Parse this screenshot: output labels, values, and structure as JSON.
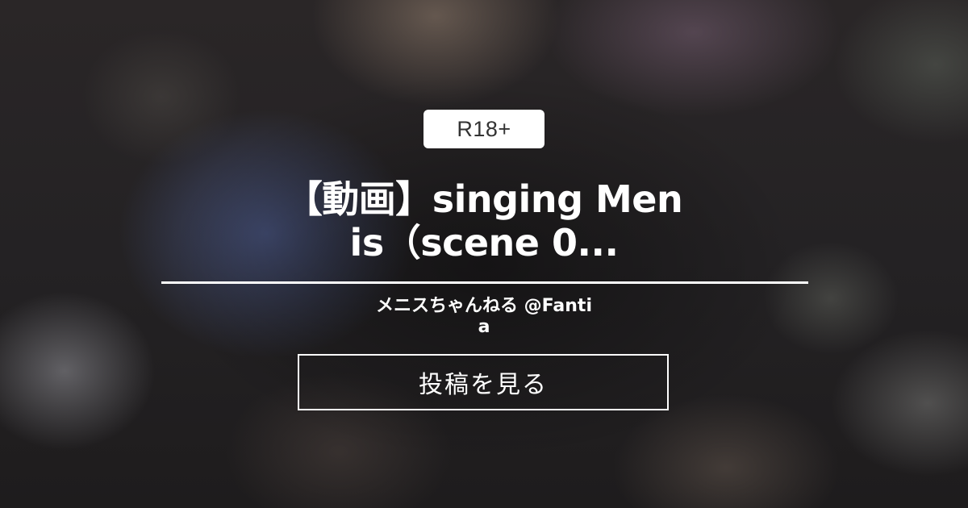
{
  "badge": {
    "label": "R18+"
  },
  "post": {
    "title_line1": "【動画】singing Men",
    "title_line2": "is（scene 0..."
  },
  "author": {
    "line1": "メニスちゃんねる @Fanti",
    "line2": "a"
  },
  "cta": {
    "label": "投稿を見る"
  },
  "colors": {
    "text": "#ffffff",
    "badge_background": "#ffffff",
    "badge_text": "#333333"
  }
}
